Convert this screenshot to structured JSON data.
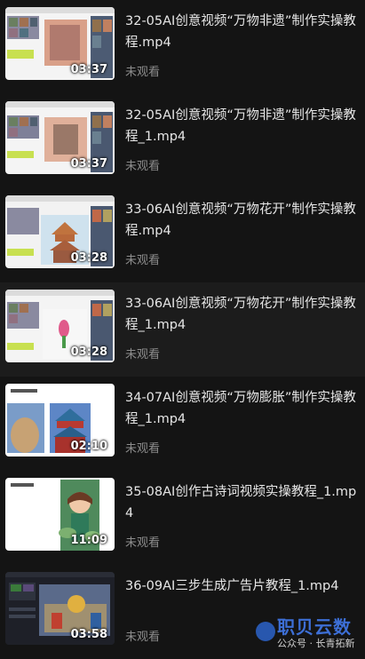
{
  "videos": [
    {
      "title": "32-05AI创意视频“万物非遗”制作实操教程.mp4",
      "duration": "03:37",
      "status": "未观看",
      "active": false,
      "scene": "app"
    },
    {
      "title": "32-05AI创意视频“万物非遗”制作实操教程_1.mp4",
      "duration": "03:37",
      "status": "未观看",
      "active": false,
      "scene": "app"
    },
    {
      "title": "33-06AI创意视频“万物花开”制作实操教程.mp4",
      "duration": "03:28",
      "status": "未观看",
      "active": false,
      "scene": "pagoda"
    },
    {
      "title": "33-06AI创意视频“万物花开”制作实操教程_1.mp4",
      "duration": "03:28",
      "status": "未观看",
      "active": true,
      "scene": "app"
    },
    {
      "title": "34-07AI创意视频“万物膨胀”制作实操教程_1.mp4",
      "duration": "02:10",
      "status": "未观看",
      "active": false,
      "scene": "temple"
    },
    {
      "title": "35-08AI创作古诗词视频实操教程_1.mp4",
      "duration": "11:09",
      "status": "未观看",
      "active": false,
      "scene": "girl"
    },
    {
      "title": "36-09AI三步生成广告片教程_1.mp4",
      "duration": "03:58",
      "status": "未观看",
      "active": false,
      "scene": "editor"
    }
  ],
  "watermark": {
    "brand": "职贝云数",
    "sub": "公众号 · 长青拓新"
  }
}
